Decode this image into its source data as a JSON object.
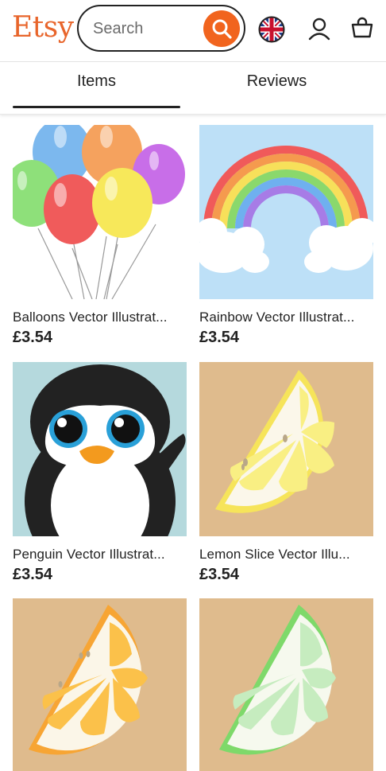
{
  "header": {
    "logo": "Etsy",
    "search_placeholder": "Search",
    "search_icon": "search-icon",
    "flag_icon": "uk-flag-icon",
    "account_icon": "user-icon",
    "cart_icon": "shopping-bag-icon",
    "brand_color": "#f1641e"
  },
  "tabs": [
    {
      "label": "Items",
      "active": true
    },
    {
      "label": "Reviews",
      "active": false
    }
  ],
  "listings": [
    {
      "title": "Balloons Vector Illustrat...",
      "price": "£3.54"
    },
    {
      "title": "Rainbow Vector Illustrat...",
      "price": "£3.54"
    },
    {
      "title": "Penguin Vector Illustrat...",
      "price": "£3.54"
    },
    {
      "title": "Lemon Slice Vector Illu...",
      "price": "£3.54"
    },
    {
      "title": "",
      "price": ""
    },
    {
      "title": "",
      "price": ""
    }
  ]
}
